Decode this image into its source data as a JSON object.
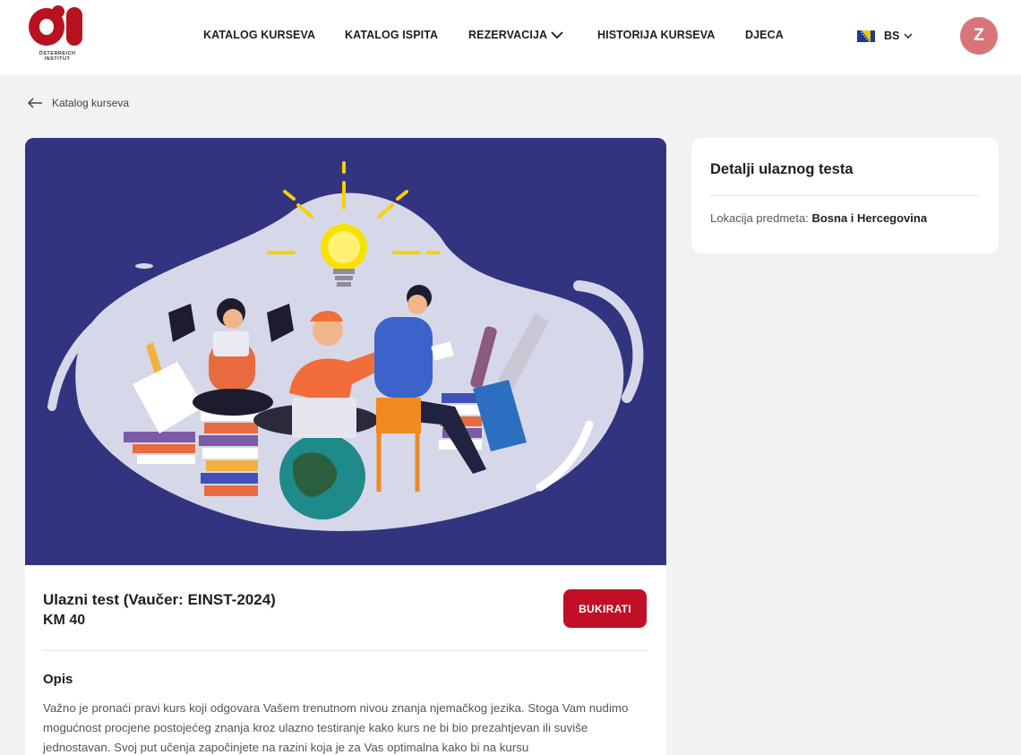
{
  "header": {
    "logo_text": "ÖSTERREICH INSTITUT",
    "nav": [
      {
        "label": "KATALOG KURSEVA"
      },
      {
        "label": "KATALOG ISPITA"
      },
      {
        "label": "REZERVACIJA"
      },
      {
        "label": "HISTORIJA KURSEVA"
      },
      {
        "label": "DJECA"
      }
    ],
    "language": "BS",
    "avatar_initial": "Z"
  },
  "breadcrumb": {
    "back_label": "Katalog kurseva"
  },
  "course": {
    "title": "Ulazni test (Vaučer: EINST-2024)",
    "price": "KM 40",
    "book_button": "BUKIRATI",
    "description_heading": "Opis",
    "description": "Važno je pronaći pravi kurs koji odgovara Vašem trenutnom nivou znanja njemačkog jezika. Stoga Vam nudimo mogućnost procjene postojećeg znanja kroz ulazno testiranje kako kurs ne bi bio prezahtjevan ili suviše jednostavan. Svoj put učenja započinjete na razini koja je za Vas optimalna kako bi na kursu"
  },
  "details": {
    "title": "Detalji ulaznog testa",
    "location_label": "Lokacija predmeta:",
    "location_value": "Bosna i Hercegovina"
  },
  "colors": {
    "brand_red": "#c10f28",
    "hero_bg": "#33347f",
    "avatar_bg": "#d9757a",
    "page_bg": "#f2f2f3"
  }
}
